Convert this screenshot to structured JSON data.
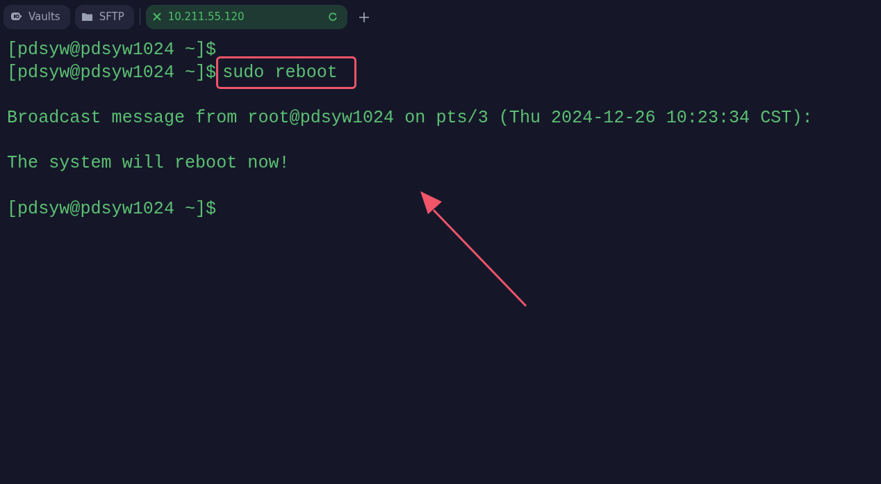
{
  "tabs": [
    {
      "label": "Vaults",
      "kind": "vaults",
      "selected": false
    },
    {
      "label": "SFTP",
      "kind": "sftp",
      "selected": false
    },
    {
      "label": "10.211.55.120",
      "kind": "host",
      "selected": true
    }
  ],
  "terminal": {
    "lines": [
      {
        "kind": "prompt",
        "prompt": "[pdsyw@pdsyw1024 ~]$"
      },
      {
        "kind": "prompt",
        "prompt": "[pdsyw@pdsyw1024 ~]$",
        "command": "sudo reboot",
        "highlighted": true
      },
      {
        "kind": "blank"
      },
      {
        "kind": "output",
        "text": "Broadcast message from root@pdsyw1024 on pts/3 (Thu 2024-12-26 10:23:34 CST):"
      },
      {
        "kind": "blank"
      },
      {
        "kind": "output",
        "text": "The system will reboot now!"
      },
      {
        "kind": "blank"
      },
      {
        "kind": "prompt",
        "prompt": "[pdsyw@pdsyw1024 ~]$"
      }
    ]
  },
  "annotation": {
    "arrow": true
  }
}
